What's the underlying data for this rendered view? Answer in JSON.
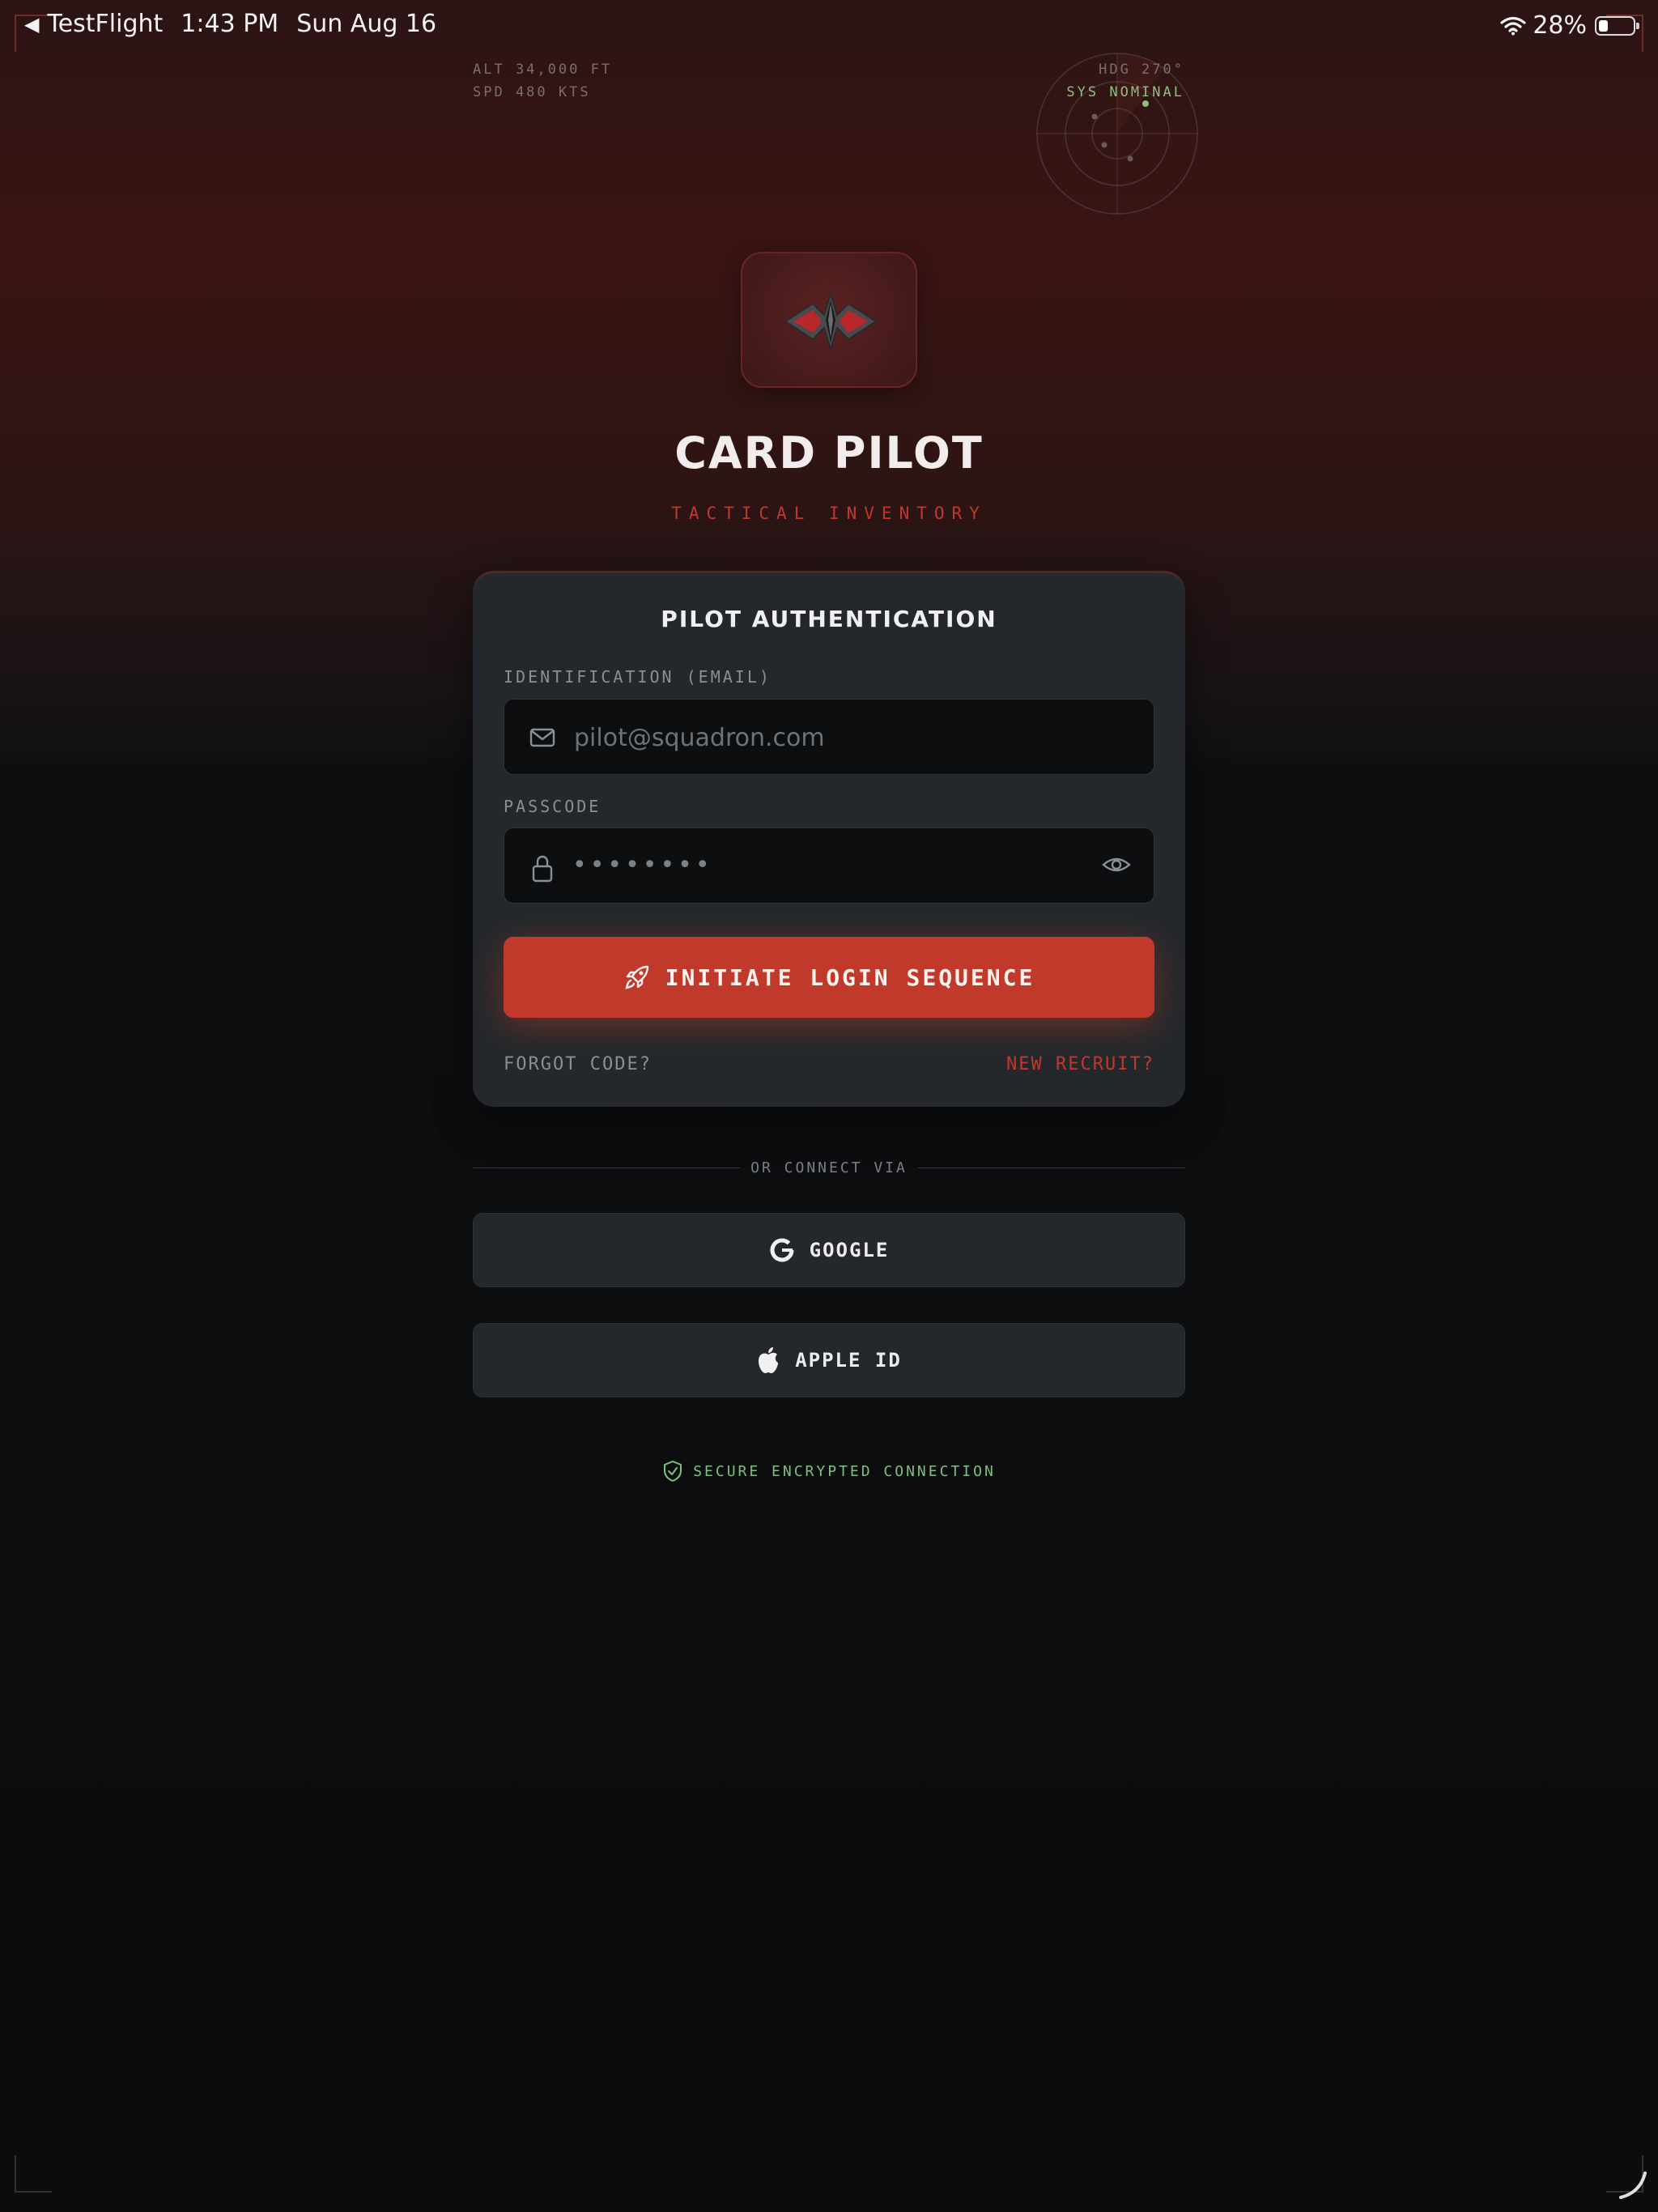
{
  "status_bar": {
    "back_app": "TestFlight",
    "time": "1:43 PM",
    "date": "Sun Aug 16",
    "battery": "28%"
  },
  "hud": {
    "altitude": "ALT 34,000 FT",
    "speed": "SPD 480 KTS",
    "heading": "HDG 270°",
    "system": "SYS NOMINAL"
  },
  "brand": {
    "title": "CARD PILOT",
    "subtitle": "TACTICAL INVENTORY"
  },
  "login_card": {
    "title": "PILOT AUTHENTICATION",
    "email_label": "IDENTIFICATION (EMAIL)",
    "email_placeholder": "pilot@squadron.com",
    "passcode_label": "PASSCODE",
    "passcode_mask": "••••••••",
    "login_button": "INITIATE LOGIN SEQUENCE",
    "forgot": "FORGOT CODE?",
    "recruit": "NEW RECRUIT?"
  },
  "alt_login": {
    "divider": "OR CONNECT VIA",
    "google": "GOOGLE",
    "apple": "APPLE ID"
  },
  "secure_notice": "SECURE ENCRYPTED CONNECTION",
  "colors": {
    "accent": "#c0392b",
    "secure_green": "#7fbf7f",
    "card_bg": "#24282c",
    "input_bg": "#0d0e10"
  },
  "icons": [
    "back-arrow-icon",
    "wifi-icon",
    "battery-icon",
    "radar-icon",
    "logo-emblem-icon",
    "mail-icon",
    "lock-icon",
    "eye-icon",
    "rocket-icon",
    "google-icon",
    "apple-icon",
    "shield-check-icon"
  ]
}
